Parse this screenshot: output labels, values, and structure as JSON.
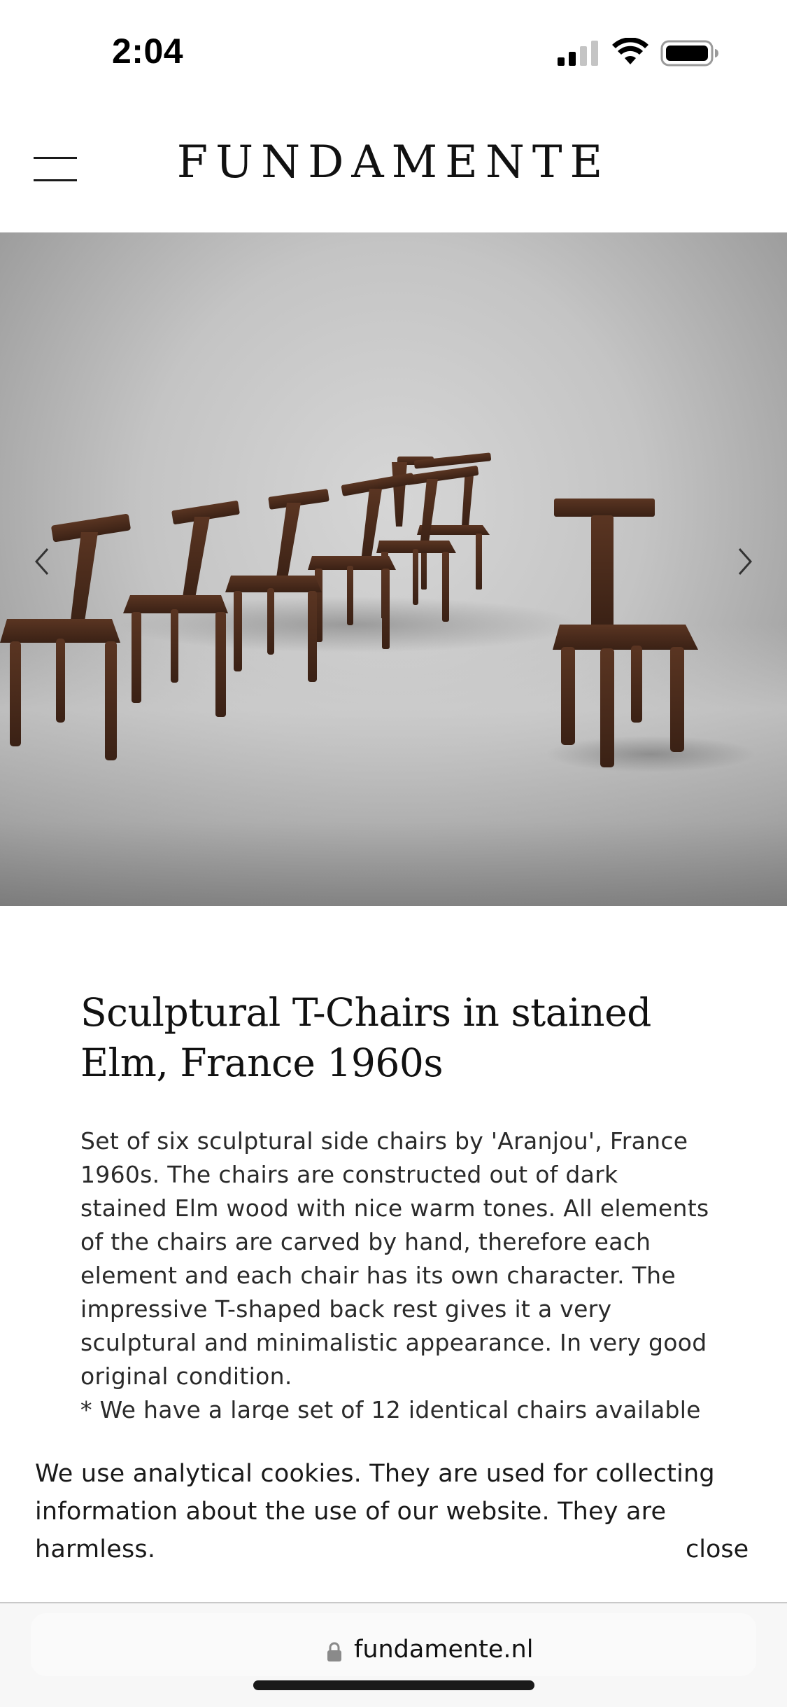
{
  "status_bar": {
    "time": "2:04"
  },
  "header": {
    "logo": "FUNDAMENTE"
  },
  "product": {
    "title": "Sculptural T-Chairs in stained Elm, France 1960s",
    "description": "Set of six sculptural side chairs by 'Aranjou', France 1960s. The chairs are constructed out of dark stained Elm wood with nice warm tones. All elements of the chairs are carved by hand, therefore each element and each chair has its own character. The impressive T-shaped back rest gives it a very sculptural and minimalistic appearance. In very good original condition.",
    "note": "* We have a large set of 12 identical chairs available"
  },
  "cookie_banner": {
    "text": "We use analytical cookies. They are used for collecting information about the use of our website. They are harmless.",
    "close_label": "close"
  },
  "browser": {
    "url": "fundamente.nl"
  },
  "icons": {
    "menu": "hamburger-menu-icon",
    "prev": "chevron-left-icon",
    "next": "chevron-right-icon",
    "lock": "lock-icon",
    "signal": "cellular-signal-icon",
    "wifi": "wifi-icon",
    "battery": "battery-icon"
  },
  "colors": {
    "chair_wood": "#4a2c1d",
    "background": "#ffffff",
    "text": "#1a1a1a"
  }
}
